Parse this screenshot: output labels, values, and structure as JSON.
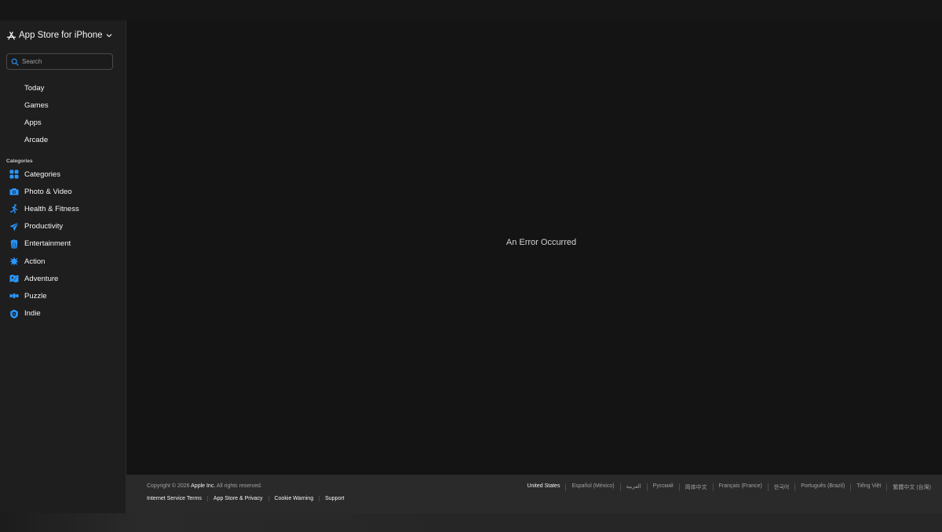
{
  "header": {
    "brand_name": "App Store",
    "brand_suffix": "for iPhone",
    "brand_icon": "app-store-icon",
    "dropdown_icon": "chevron-down-icon"
  },
  "search": {
    "placeholder": "Search",
    "value": ""
  },
  "nav": {
    "items": [
      {
        "label": "Today"
      },
      {
        "label": "Games"
      },
      {
        "label": "Apps"
      },
      {
        "label": "Arcade"
      }
    ]
  },
  "categories": {
    "heading": "Categories",
    "items": [
      {
        "label": "Categories",
        "icon": "grid-icon"
      },
      {
        "label": "Photo & Video",
        "icon": "camera-icon"
      },
      {
        "label": "Health & Fitness",
        "icon": "running-icon"
      },
      {
        "label": "Productivity",
        "icon": "paper-plane-icon"
      },
      {
        "label": "Entertainment",
        "icon": "popcorn-icon"
      },
      {
        "label": "Action",
        "icon": "explosion-icon"
      },
      {
        "label": "Adventure",
        "icon": "map-icon"
      },
      {
        "label": "Puzzle",
        "icon": "puzzle-icon"
      },
      {
        "label": "Indie",
        "icon": "shield-icon"
      }
    ]
  },
  "main": {
    "error_message": "An Error Occurred"
  },
  "footer": {
    "copyright_prefix": "Copyright © 2026",
    "copyright_company": "Apple Inc.",
    "copyright_suffix": "All rights reserved.",
    "legal_links": [
      "Internet Service Terms",
      "App Store & Privacy",
      "Cookie Warning",
      "Support"
    ],
    "languages": [
      "United States",
      "Español (México)",
      "العربية",
      "Русский",
      "简体中文",
      "Français (France)",
      "한국어",
      "Português (Brazil)",
      "Tiếng Việt",
      "繁體中文 (台灣)"
    ]
  },
  "colors": {
    "accent": "#2997ff",
    "background": "#141414",
    "sidebar": "#1e1e1e",
    "footer": "#2a2a2a"
  }
}
